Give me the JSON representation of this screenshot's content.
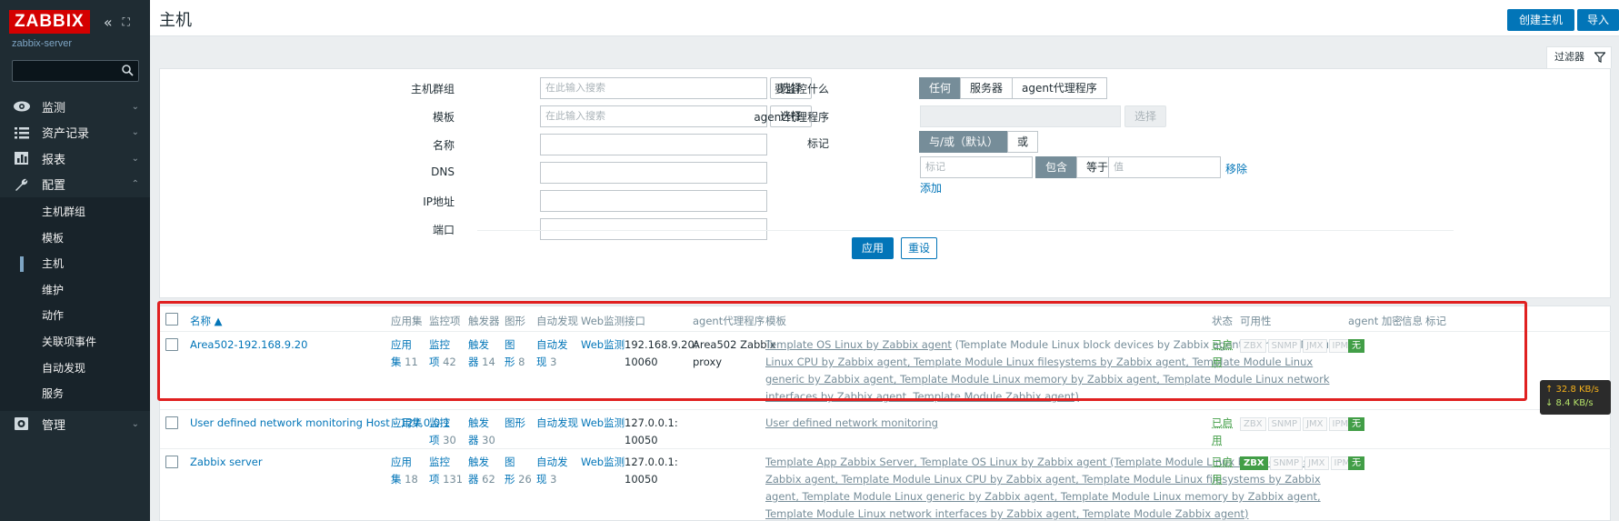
{
  "sidebar": {
    "logo": "ZABBIX",
    "collapse_icon": "«",
    "kiosk_icon": "⛶",
    "server_name": "zabbix-server",
    "menu": [
      {
        "label": "监测",
        "icon": "eye-icon"
      },
      {
        "label": "资产记录",
        "icon": "list-icon"
      },
      {
        "label": "报表",
        "icon": "chart-icon"
      },
      {
        "label": "配置",
        "icon": "wrench-icon"
      }
    ],
    "config_submenu": [
      "主机群组",
      "模板",
      "主机",
      "维护",
      "动作",
      "关联项事件",
      "自动发现",
      "服务"
    ],
    "admin": {
      "label": "管理",
      "icon": "gear-icon"
    }
  },
  "header": {
    "title": "主机",
    "create_host": "创建主机",
    "import": "导入"
  },
  "filter": {
    "tab_label": "过滤器",
    "host_groups_label": "主机群组",
    "host_groups_placeholder": "在此输入搜索",
    "templates_label": "模板",
    "templates_placeholder": "在此输入搜索",
    "select_label": "选择",
    "name_label": "名称",
    "dns_label": "DNS",
    "ip_label": "IP地址",
    "port_label": "端口",
    "monitored_by_label": "要监控什么",
    "monitored_by_options": [
      "任何",
      "服务器",
      "agent代理程序"
    ],
    "proxy_label": "agent代理程序",
    "tags_label": "标记",
    "tags_eval_options": [
      "与/或（默认）",
      "或"
    ],
    "tag_placeholder": "标记",
    "tag_operator_options": [
      "包含",
      "等于"
    ],
    "value_placeholder": "值",
    "remove_label": "移除",
    "add_label": "添加",
    "apply_label": "应用",
    "reset_label": "重设"
  },
  "table": {
    "columns": {
      "name": "名称 ▲",
      "applications": "应用集",
      "items": "监控项",
      "triggers": "触发器",
      "graphs": "图形",
      "discovery": "自动发现",
      "web": "Web监测",
      "interface": "接口",
      "proxy": "agent代理程序",
      "templates": "模板",
      "status": "状态",
      "availability": "可用性",
      "agent_encryption": "agent 加密",
      "info": "信息",
      "tags": "标记"
    },
    "rows": [
      {
        "name": "Area502-192.168.9.20",
        "apps_a": "应用",
        "apps_b": "集",
        "apps_n": "11",
        "items_a": "监控",
        "items_b": "项",
        "items_n": "42",
        "triggers_a": "触发",
        "triggers_b": "器",
        "triggers_n": "14",
        "graphs_a": "图",
        "graphs_b": "形",
        "graphs_n": "8",
        "disc_a": "自动发",
        "disc_b": "现",
        "disc_n": "3",
        "web": "Web监测",
        "iface_a": "192.168.9.20:",
        "iface_b": "10060",
        "proxy_a": "Area502 Zabbix",
        "proxy_b": "proxy",
        "tpl_1": "Template OS Linux by Zabbix agent",
        "tpl_2": " (Template Module Linux block devices by Zabbix agent, Template Module",
        "tpl_3": "Linux CPU by Zabbix agent, Template Module Linux filesystems by Zabbix agent, Template Module Linux",
        "tpl_4": "generic by Zabbix agent, Template Module Linux memory by Zabbix agent, Template Module Linux network",
        "tpl_5": "interfaces by Zabbix agent, Template Module Zabbix agent)",
        "status_a": "已启",
        "status_b": "用",
        "avail": [
          "ZBX",
          "SNMP",
          "JMX",
          "IPMI"
        ],
        "encryption": "无"
      },
      {
        "name": "User defined network monitoring Host - 127.0.0.1",
        "apps_a": "应用集",
        "items_a": "监控",
        "items_b": "项",
        "items_n": "30",
        "triggers_a": "触发",
        "triggers_b": "器",
        "triggers_n": "30",
        "graphs_a": "图形",
        "disc_a": "自动发现",
        "web": "Web监测",
        "iface_a": "127.0.0.1:",
        "iface_b": "10050",
        "tpl_1": "User defined network monitoring",
        "status_a": "已启",
        "status_b": "用",
        "avail": [
          "ZBX",
          "SNMP",
          "JMX",
          "IPMI"
        ],
        "encryption": "无"
      },
      {
        "name": "Zabbix server",
        "apps_a": "应用",
        "apps_b": "集",
        "apps_n": "18",
        "items_a": "监控",
        "items_b": "项",
        "items_n": "131",
        "triggers_a": "触发",
        "triggers_b": "器",
        "triggers_n": "62",
        "graphs_a": "图",
        "graphs_b": "形",
        "graphs_n": "26",
        "disc_a": "自动发",
        "disc_b": "现",
        "disc_n": "3",
        "web": "Web监测",
        "iface_a": "127.0.0.1:",
        "iface_b": "10050",
        "tpl_1": "Template App Zabbix Server, Template OS Linux by Zabbix agent (Template Module Linux block devices by",
        "tpl_2": "Zabbix agent, Template Module Linux CPU by Zabbix agent, Template Module Linux filesystems by Zabbix",
        "tpl_3": "agent, Template Module Linux generic by Zabbix agent, Template Module Linux memory by Zabbix agent,",
        "tpl_4": "Template Module Linux network interfaces by Zabbix agent, Template Module Zabbix agent)",
        "status_a": "已启",
        "status_b": "用",
        "avail": [
          "ZBX",
          "SNMP",
          "JMX",
          "IPMI"
        ],
        "encryption": "无"
      }
    ]
  },
  "net_widget": {
    "up": "↑ 32.8 KB/s",
    "down": "↓ 8.4 KB/s"
  },
  "colors": {
    "sidebar_bg": "#1f2c33",
    "accent_blue": "#0275b8",
    "status_green": "#429e47",
    "logo_red": "#d40000",
    "highlight_red": "#e02020"
  }
}
